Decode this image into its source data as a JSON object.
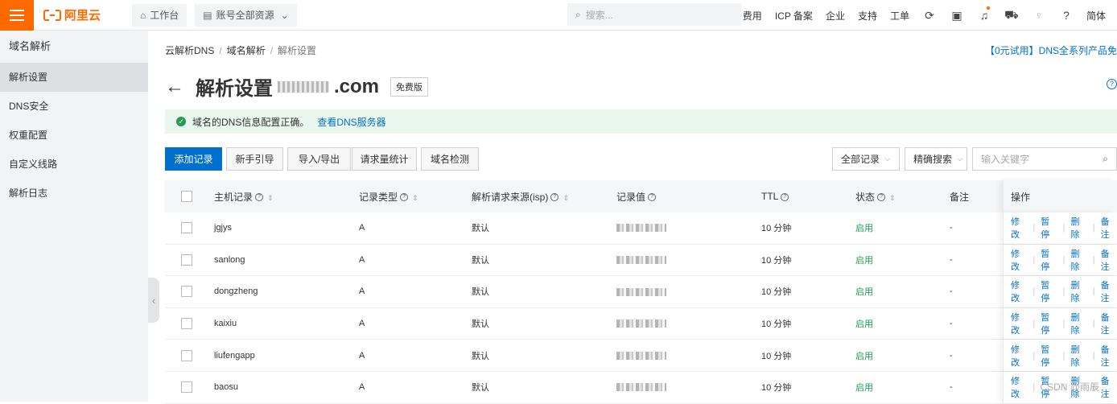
{
  "topbar": {
    "logo": "阿里云",
    "workbench": "工作台",
    "account": "账号全部资源",
    "search_placeholder": "搜索...",
    "links": [
      "费用",
      "ICP 备案",
      "企业",
      "支持",
      "工单"
    ],
    "lang": "简体",
    "icons": [
      "sync-icon",
      "terminal-icon",
      "bell-icon",
      "cart-icon",
      "lightbulb-icon",
      "help-icon"
    ]
  },
  "sidebar": {
    "title": "域名解析",
    "items": [
      "解析设置",
      "DNS安全",
      "权重配置",
      "自定义线路",
      "解析日志"
    ]
  },
  "breadcrumb": [
    "云解析DNS",
    "域名解析",
    "解析设置"
  ],
  "promo": "【0元试用】DNS全系列产品免",
  "page": {
    "title": "解析设置",
    "domain_suffix": ".com",
    "edition": "免费版"
  },
  "notice": {
    "text": "域名的DNS信息配置正确。",
    "link": "查看DNS服务器"
  },
  "toolbar": {
    "buttons": [
      "添加记录",
      "新手引导",
      "导入/导出",
      "请求量统计",
      "域名检测"
    ],
    "filter_all": "全部记录",
    "filter_exact": "精确搜索",
    "keyword_placeholder": "输入关键字"
  },
  "table": {
    "headers": {
      "host": "主机记录",
      "type": "记录类型",
      "isp": "解析请求来源(isp)",
      "value": "记录值",
      "ttl": "TTL",
      "status": "状态",
      "remark": "备注",
      "ops": "操作"
    },
    "rows": [
      {
        "host": "jgjys",
        "type": "A",
        "isp": "默认",
        "ttl": "10 分钟",
        "status": "启用",
        "remark": "-"
      },
      {
        "host": "sanlong",
        "type": "A",
        "isp": "默认",
        "ttl": "10 分钟",
        "status": "启用",
        "remark": "-"
      },
      {
        "host": "dongzheng",
        "type": "A",
        "isp": "默认",
        "ttl": "10 分钟",
        "status": "启用",
        "remark": "-"
      },
      {
        "host": "kaixiu",
        "type": "A",
        "isp": "默认",
        "ttl": "10 分钟",
        "status": "启用",
        "remark": "-"
      },
      {
        "host": "liufengapp",
        "type": "A",
        "isp": "默认",
        "ttl": "10 分钟",
        "status": "启用",
        "remark": "-"
      },
      {
        "host": "baosu",
        "type": "A",
        "isp": "默认",
        "ttl": "10 分钟",
        "status": "启用",
        "remark": "-"
      }
    ],
    "row_actions": [
      "修改",
      "暂停",
      "删除",
      "备注"
    ]
  },
  "watermark": "CSDN @雨辰",
  "colors": {
    "brand": "#ff6a00",
    "primary": "#0070cc",
    "success": "#1f9d55"
  }
}
